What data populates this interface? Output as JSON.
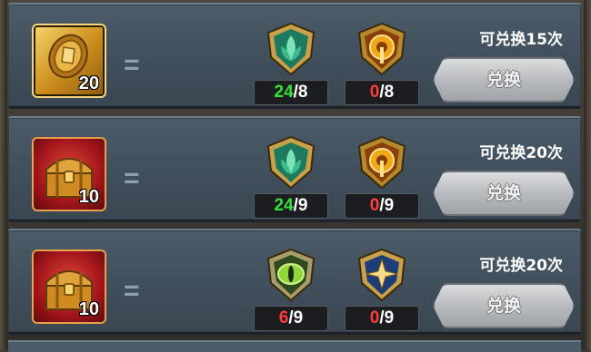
{
  "rows": [
    {
      "reward": {
        "kind": "gold-coin",
        "quantity": "20"
      },
      "equals_symbol": "=",
      "costs": [
        {
          "icon": "green-leaf-emblem-icon",
          "have": "24",
          "need": "/8",
          "have_color": "#37e13a"
        },
        {
          "icon": "orange-ring-emblem-icon",
          "have": "0",
          "need": "/8",
          "have_color": "#ff3b3b"
        }
      ],
      "limit_text": "可兑换15次",
      "button_label": "兑换"
    },
    {
      "reward": {
        "kind": "gold-chest",
        "quantity": "10"
      },
      "equals_symbol": "=",
      "costs": [
        {
          "icon": "green-leaf-emblem-icon",
          "have": "24",
          "need": "/9",
          "have_color": "#37e13a"
        },
        {
          "icon": "orange-ring-emblem-icon",
          "have": "0",
          "need": "/9",
          "have_color": "#ff3b3b"
        }
      ],
      "limit_text": "可兑换20次",
      "button_label": "兑换"
    },
    {
      "reward": {
        "kind": "gold-chest",
        "quantity": "10"
      },
      "equals_symbol": "=",
      "costs": [
        {
          "icon": "green-eye-emblem-icon",
          "have": "6",
          "need": "/9",
          "have_color": "#ff3b3b"
        },
        {
          "icon": "blue-star-emblem-icon",
          "have": "0",
          "need": "/9",
          "have_color": "#ff3b3b"
        }
      ],
      "limit_text": "可兑换20次",
      "button_label": "兑换"
    }
  ]
}
